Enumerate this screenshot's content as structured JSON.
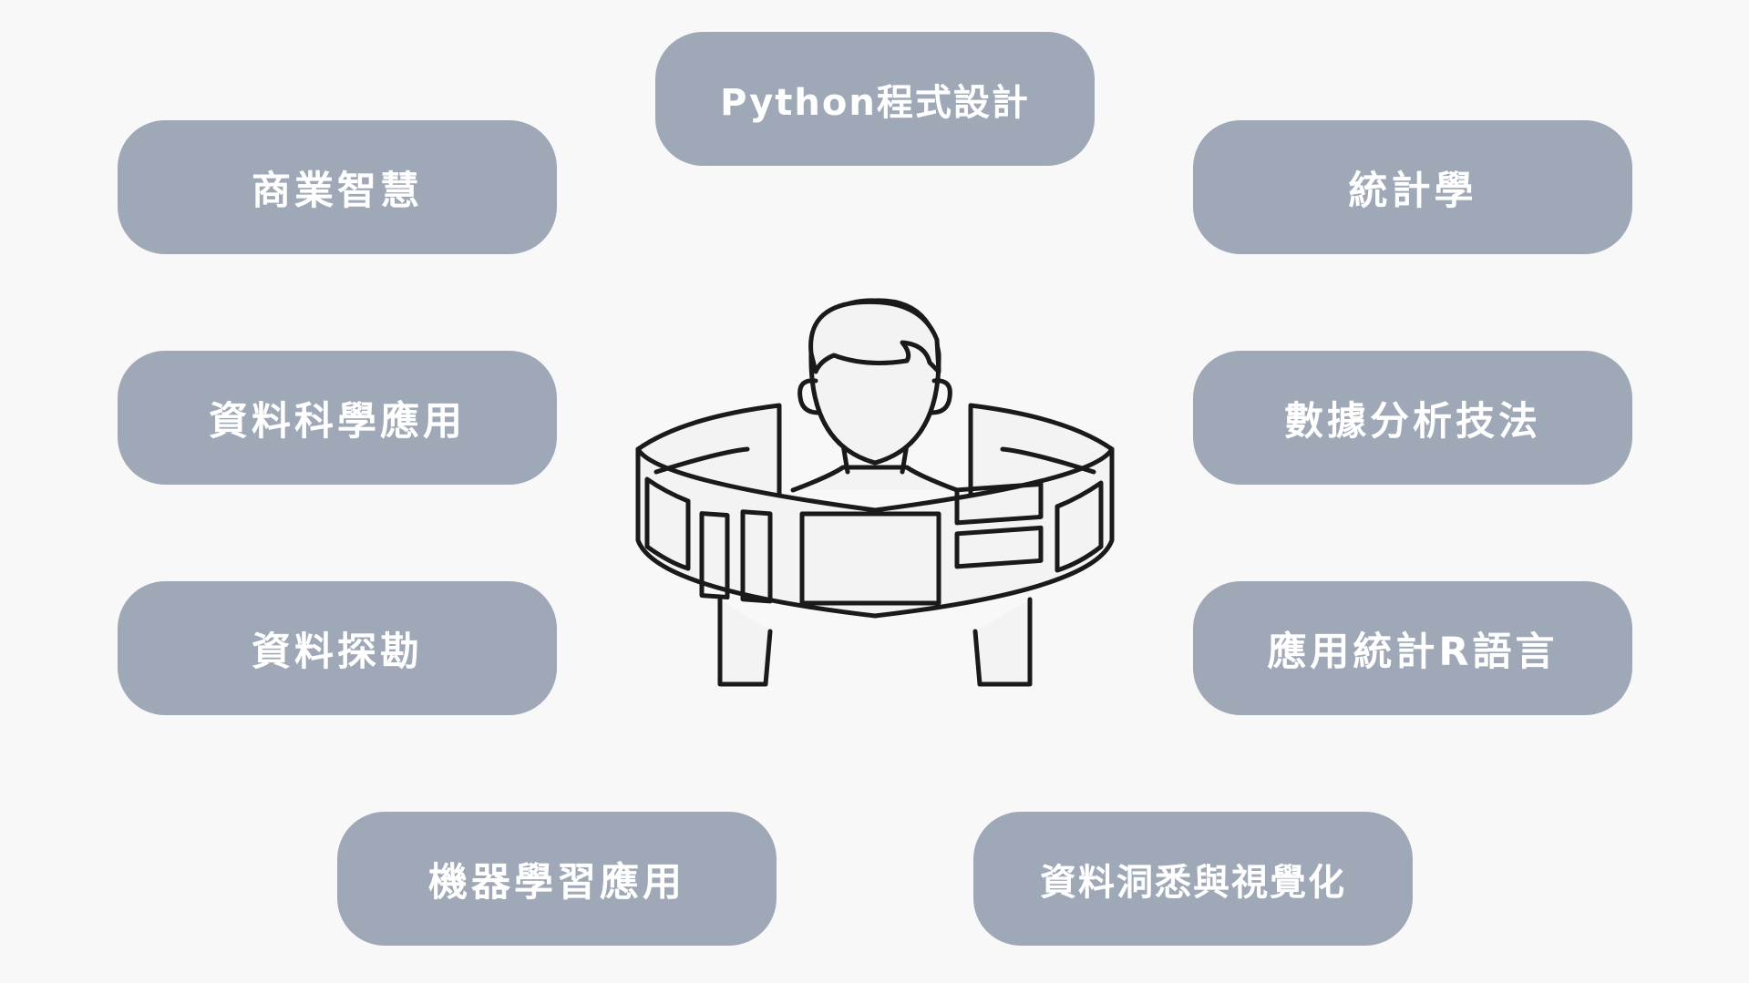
{
  "topics": {
    "python": "Python程式設計",
    "business_intelligence": "商業智慧",
    "statistics": "統計學",
    "data_science_applications": "資料科學應用",
    "data_analysis_techniques": "數據分析技法",
    "data_mining": "資料探勘",
    "applied_statistics_r": "應用統計R語言",
    "machine_learning_applications": "機器學習應用",
    "data_insight_visualization": "資料洞悉與視覺化"
  },
  "colors": {
    "background": "#f8f8f8",
    "pill": "#9fa8b7",
    "pill_text": "#ffffff",
    "stroke": "#1a1a1a",
    "fill": "#f3f3f3"
  },
  "icons": {
    "center": "person-with-data-dashboard-ring-icon"
  }
}
